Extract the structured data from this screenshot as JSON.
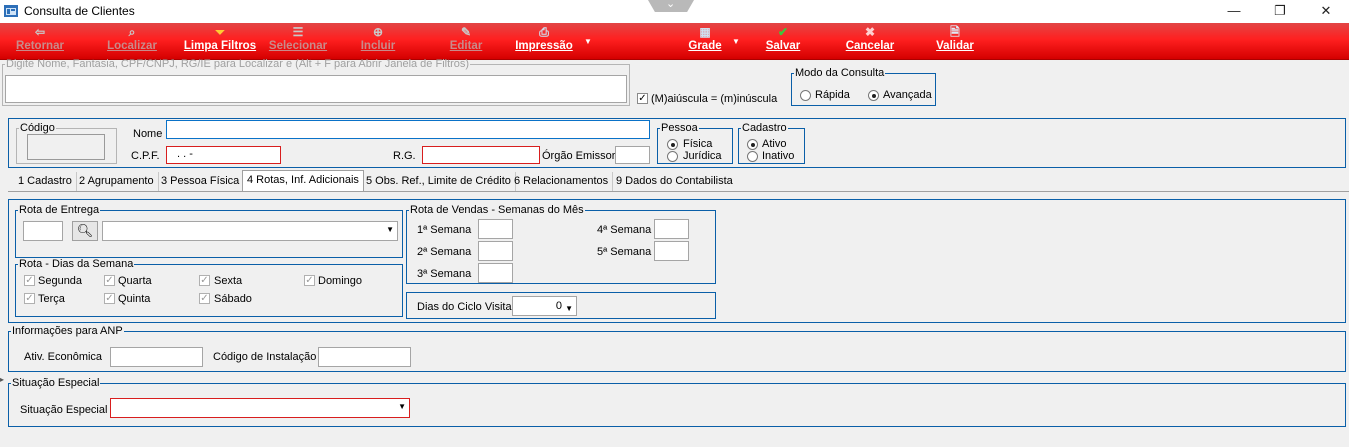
{
  "window": {
    "title": "Consulta de Clientes",
    "minimize": "—",
    "restore": "❐",
    "close": "✕"
  },
  "toolbar": {
    "buttons": [
      {
        "label": "Retornar",
        "icon": "⇦"
      },
      {
        "label": "Localizar",
        "icon": "⌕"
      },
      {
        "label": "Limpa Filtros",
        "icon": "⏷"
      },
      {
        "label": "Selecionar",
        "icon": "☰"
      },
      {
        "label": "Incluir",
        "icon": "⊕"
      },
      {
        "label": "Editar",
        "icon": "✎"
      },
      {
        "label": "Impressão",
        "icon": "⎙"
      },
      {
        "label": "Grade",
        "icon": "▦"
      },
      {
        "label": "Salvar",
        "icon": "✔"
      },
      {
        "label": "Cancelar",
        "icon": "✖"
      },
      {
        "label": "Validar",
        "icon": "🗎"
      }
    ],
    "colors": {
      "bar": "#ff2020",
      "disabled_text": "#c98a8a"
    }
  },
  "search": {
    "legend": "Digite Nome, Fantasia, CPF/CNPJ, RG/IE para Localizar e (Alt + F para Abrir Janela de Filtros)",
    "value": "",
    "case_label": "(M)aiúscula = (m)inúscula",
    "case_checked": true
  },
  "mode": {
    "legend": "Modo da Consulta",
    "options": [
      "Rápida",
      "Avançada"
    ],
    "selected": "Avançada"
  },
  "header": {
    "codigo_legend": "Código",
    "nome_label": "Nome",
    "cpf_label": "C.P.F.",
    "cpf_value": " .   .    -",
    "rg_label": "R.G.",
    "orgao_label": "Órgão Emissor",
    "pessoa_legend": "Pessoa",
    "pessoa_options": [
      "Física",
      "Jurídica"
    ],
    "pessoa_selected": "Física",
    "cadastro_legend": "Cadastro",
    "cadastro_options": [
      "Ativo",
      "Inativo"
    ],
    "cadastro_selected": "Ativo"
  },
  "tabs": [
    "1 Cadastro",
    "2 Agrupamento",
    "3 Pessoa Física",
    "4 Rotas, Inf. Adicionais",
    "5 Obs. Ref., Limite de Crédito",
    "6 Relacionamentos",
    "9 Dados do Contabilista"
  ],
  "active_tab": "4 Rotas, Inf. Adicionais",
  "rota_entrega": {
    "legend": "Rota de Entrega",
    "code": "",
    "name": ""
  },
  "rota_dias": {
    "legend": "Rota - Dias da Semana",
    "days": [
      "Segunda",
      "Quarta",
      "Sexta",
      "Domingo",
      "Terça",
      "Quinta",
      "Sábado"
    ]
  },
  "rota_vendas": {
    "legend": "Rota de Vendas - Semanas do Mês",
    "weeks": [
      "1ª Semana",
      "2ª Semana",
      "3ª Semana",
      "4ª Semana",
      "5ª Semana"
    ]
  },
  "ciclo": {
    "label": "Dias do Ciclo Visita",
    "value": "0"
  },
  "anp": {
    "legend": "Informações para ANP",
    "ativ_label": "Ativ. Econômica",
    "instalacao_label": "Código de Instalação",
    "ativ_value": "",
    "instalacao_value": ""
  },
  "situacao": {
    "legend": "Situação Especial",
    "label": "Situação Especial",
    "value": ""
  }
}
